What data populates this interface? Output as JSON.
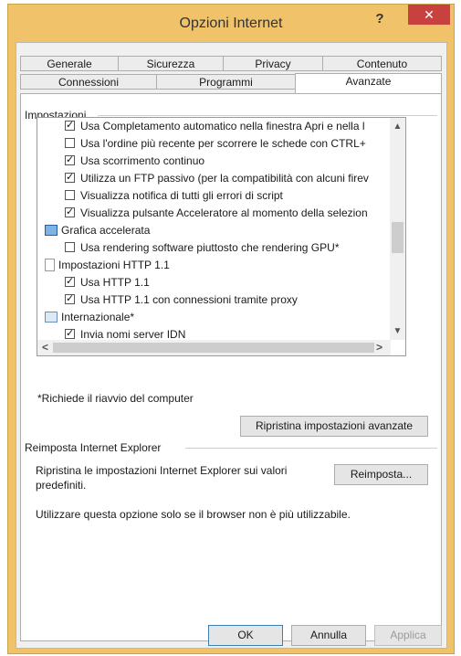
{
  "window": {
    "title": "Opzioni Internet",
    "help_glyph": "?",
    "close_glyph": "✕"
  },
  "tabs_row1": [
    "Generale",
    "Sicurezza",
    "Privacy",
    "Contenuto"
  ],
  "tabs_row2": [
    "Connessioni",
    "Programmi",
    "Avanzate"
  ],
  "active_tab": "Avanzate",
  "settings": {
    "group_label": "Impostazioni",
    "items": [
      {
        "text": "Usa Completamento automatico nella finestra Apri e nella l",
        "type": "checkbox",
        "checked": true
      },
      {
        "text": "Usa l'ordine più recente per scorrere le schede con CTRL+",
        "type": "checkbox",
        "checked": false
      },
      {
        "text": "Usa scorrimento continuo",
        "type": "checkbox",
        "checked": true
      },
      {
        "text": "Utilizza un FTP passivo (per la compatibilità con alcuni firev",
        "type": "checkbox",
        "checked": true
      },
      {
        "text": "Visualizza notifica di tutti gli errori di script",
        "type": "checkbox",
        "checked": false
      },
      {
        "text": "Visualizza pulsante Acceleratore al momento della selezion",
        "type": "checkbox",
        "checked": true
      },
      {
        "text": "Grafica accelerata",
        "type": "category",
        "icon": "monitor-icon"
      },
      {
        "text": "Usa rendering software piuttosto che rendering GPU*",
        "type": "checkbox",
        "checked": false
      },
      {
        "text": "Impostazioni HTTP 1.1",
        "type": "category",
        "icon": "page-icon"
      },
      {
        "text": "Usa HTTP 1.1",
        "type": "checkbox",
        "checked": true
      },
      {
        "text": "Usa HTTP 1.1 con connessioni tramite proxy",
        "type": "checkbox",
        "checked": true
      },
      {
        "text": "Internazionale*",
        "type": "category",
        "icon": "globe-icon"
      },
      {
        "text": "Invia nomi server IDN",
        "type": "checkbox",
        "checked": true
      }
    ],
    "scroll_up": "▲",
    "scroll_down": "▼",
    "scroll_left": "<",
    "scroll_right": ">",
    "restart_note": "*Richiede il riavvio del computer",
    "restore_button": "Ripristina impostazioni avanzate"
  },
  "reset": {
    "group_label": "Reimposta Internet Explorer",
    "description": "Ripristina le impostazioni Internet Explorer sui valori predefiniti.",
    "button": "Reimposta...",
    "note": "Utilizzare questa opzione solo se il browser non è più utilizzabile."
  },
  "footer": {
    "ok": "OK",
    "cancel": "Annulla",
    "apply": "Applica"
  }
}
